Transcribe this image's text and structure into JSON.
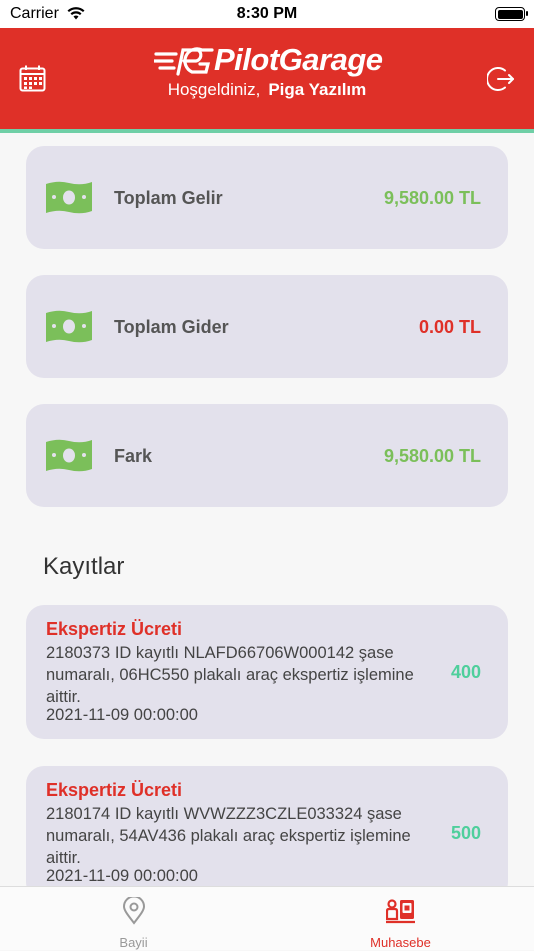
{
  "status_bar": {
    "carrier": "Carrier",
    "time": "8:30 PM"
  },
  "header": {
    "logo_text": "PilotGarage",
    "welcome": "Hoşgeldiniz,",
    "user_name": "Piga Yazılım",
    "brand_color": "#df3028",
    "accent_stripe": "#6fcfa6"
  },
  "summary": [
    {
      "label": "Toplam Gelir",
      "value": "9,580.00 TL",
      "color": "#7bbf5a",
      "icon": "money-icon"
    },
    {
      "label": "Toplam Gider",
      "value": "0.00 TL",
      "color": "#df3028",
      "icon": "money-icon"
    },
    {
      "label": "Fark",
      "value": "9,580.00 TL",
      "color": "#7bbf5a",
      "icon": "money-icon"
    }
  ],
  "records_title": "Kayıtlar",
  "records": [
    {
      "title": "Ekspertiz Ücreti",
      "description": "2180373 ID kayıtlı NLAFD66706W000142 şase numaralı, 06HC550 plakalı araç ekspertiz işlemine aittir.",
      "date": "2021-11-09 00:00:00",
      "amount": "400"
    },
    {
      "title": "Ekspertiz Ücreti",
      "description": "2180174 ID kayıtlı WVWZZZ3CZLE033324 şase numaralı, 54AV436 plakalı araç ekspertiz işlemine aittir.",
      "date": "2021-11-09 00:00:00",
      "amount": "500"
    }
  ],
  "tabs": [
    {
      "label": "Bayii",
      "icon": "location-pin-icon",
      "active": false,
      "color": "#999999"
    },
    {
      "label": "Muhasebe",
      "icon": "accounting-icon",
      "active": true,
      "color": "#df3028"
    }
  ]
}
